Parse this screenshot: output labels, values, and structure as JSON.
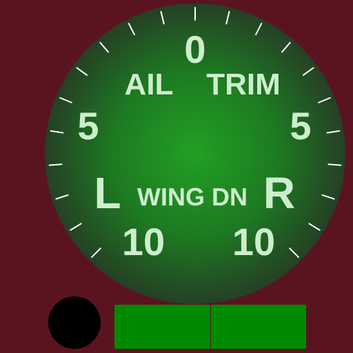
{
  "gauge": {
    "title_left": "AIL",
    "title_right": "TRIM",
    "scale_top": "0",
    "scale_mid_left": "5",
    "scale_mid_right": "5",
    "scale_bottom_left": "10",
    "scale_bottom_right": "10",
    "side_left": "L",
    "side_right": "R",
    "caption": "WING DN"
  },
  "colors": {
    "background": "#5a1420",
    "face_center": "#22a022",
    "face_edge": "#254025",
    "text": "#cdeecd",
    "pad": "#008a00"
  },
  "controls": {
    "left_knob": "black-circle",
    "pad_left": "green-button",
    "pad_right": "green-button"
  }
}
